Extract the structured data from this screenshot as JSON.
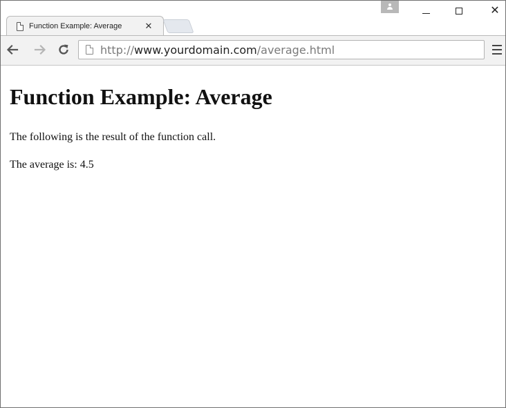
{
  "browser": {
    "tab": {
      "title": "Function Example: Average",
      "close_glyph": "✕",
      "icon": "page-icon"
    },
    "window_controls": {
      "minimize_icon": "minimize-icon",
      "maximize_icon": "maximize-icon",
      "close_glyph": "✕"
    },
    "toolbar": {
      "back_icon": "back-arrow-icon",
      "forward_icon": "forward-arrow-icon",
      "reload_icon": "reload-icon",
      "menu_icon": "hamburger-menu-icon"
    },
    "address_bar": {
      "scheme": "http://",
      "host": "www.yourdomain.com",
      "path": "/average.html"
    },
    "colors": {
      "toolbar_bg": "#f2f2f2",
      "url_dim": "#7a7a7a",
      "url_host": "#222222"
    }
  },
  "page": {
    "heading": "Function Example: Average",
    "paragraph_1": "The following is the result of the function call.",
    "paragraph_2": "The average is: 4.5"
  }
}
